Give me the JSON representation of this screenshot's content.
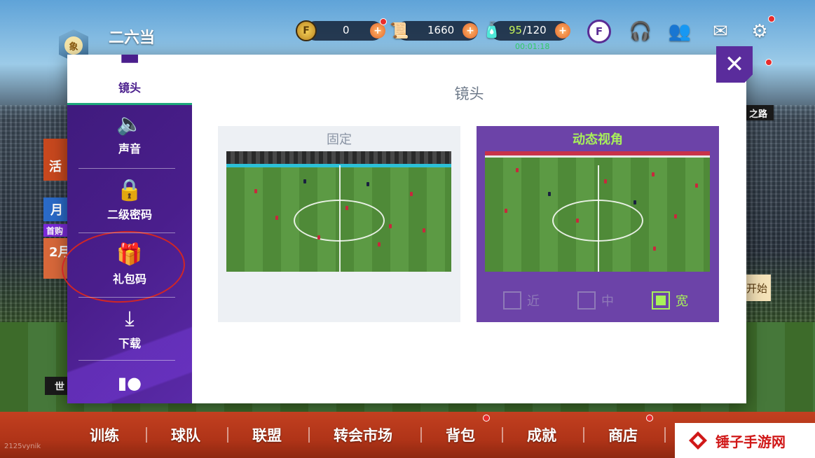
{
  "player": {
    "name": "二六当",
    "badge_text": "象"
  },
  "resources": {
    "coins": "0",
    "contracts": "1660",
    "stamina_current": "95",
    "stamina_max": "/120",
    "stamina_timer": "00:01:18",
    "tf_icon": "F",
    "coin_icon": "F",
    "plus": "+"
  },
  "side_hints": {
    "activity": "活",
    "month": "月",
    "first": "首购",
    "feb": "2月",
    "world": "世",
    "road": "之路",
    "start": "开始"
  },
  "settings": {
    "menu": [
      {
        "label": "镜头",
        "icon": "camera-icon",
        "active": true
      },
      {
        "label": "声音",
        "icon": "speaker-icon"
      },
      {
        "label": "二级密码",
        "icon": "lock-icon"
      },
      {
        "label": "礼包码",
        "icon": "gift-icon"
      },
      {
        "label": "下载",
        "icon": "download-icon"
      },
      {
        "label": "",
        "icon": "account-icon"
      }
    ],
    "title": "镜头",
    "camera_options": [
      {
        "label": "固定",
        "selected": false
      },
      {
        "label": "动态视角",
        "selected": true
      }
    ],
    "zoom_options": [
      {
        "label": "近",
        "checked": false
      },
      {
        "label": "中",
        "checked": false
      },
      {
        "label": "宽",
        "checked": true
      }
    ],
    "close_label": "✕"
  },
  "bottom_nav": [
    "训练",
    "球队",
    "联盟",
    "转会市场",
    "背包",
    "成就",
    "商店"
  ],
  "uid": "2125vynik",
  "watermark": "锤子手游网",
  "colors": {
    "sidebar": "#4a1e8c",
    "accent_green": "#a8f05a",
    "nav_red": "#b03418"
  }
}
